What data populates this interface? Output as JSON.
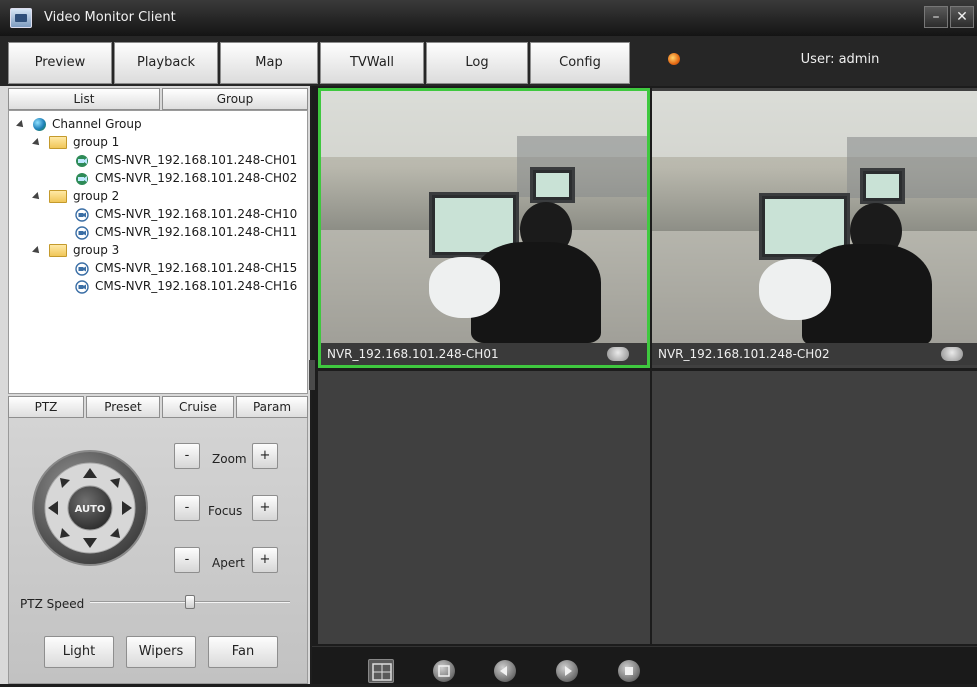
{
  "window": {
    "title": "Video Monitor Client",
    "minimize_glyph": "–",
    "close_glyph": "✕"
  },
  "nav": {
    "tabs": [
      {
        "label": "Preview"
      },
      {
        "label": "Playback"
      },
      {
        "label": "Map"
      },
      {
        "label": "TVWall"
      },
      {
        "label": "Log"
      },
      {
        "label": "Config"
      }
    ],
    "user_label": "User: admin"
  },
  "left": {
    "tabs": [
      "List",
      "Group"
    ],
    "tree": {
      "root": "Channel Group",
      "groups": [
        {
          "name": "group 1",
          "channels": [
            "CMS-NVR_192.168.101.248-CH01",
            "CMS-NVR_192.168.101.248-CH02"
          ]
        },
        {
          "name": "group 2",
          "channels": [
            "CMS-NVR_192.168.101.248-CH10",
            "CMS-NVR_192.168.101.248-CH11"
          ]
        },
        {
          "name": "group 3",
          "channels": [
            "CMS-NVR_192.168.101.248-CH15",
            "CMS-NVR_192.168.101.248-CH16"
          ]
        }
      ]
    },
    "ptz_tabs": [
      "PTZ",
      "Preset",
      "Cruise",
      "Param"
    ],
    "ptz": {
      "auto_label": "AUTO",
      "controls": [
        {
          "label": "Zoom",
          "minus": "-",
          "plus": "+"
        },
        {
          "label": "Focus",
          "minus": "-",
          "plus": "+"
        },
        {
          "label": "Apert",
          "minus": "-",
          "plus": "+"
        }
      ],
      "speed_label": "PTZ Speed",
      "speed_level": 0.5,
      "buttons": [
        "Light",
        "Wipers",
        "Fan"
      ]
    }
  },
  "video": {
    "tiles": [
      {
        "caption": "NVR_192.168.101.248-CH01",
        "selected": true
      },
      {
        "caption": "NVR_192.168.101.248-CH02",
        "selected": false
      },
      {
        "caption": "",
        "selected": false
      },
      {
        "caption": "",
        "selected": false
      }
    ],
    "selected_border_color": "#3fc83f",
    "toolbar_icons": [
      "layout-grid-icon",
      "fullscreen-icon",
      "previous-icon",
      "next-icon",
      "stop-all-icon"
    ]
  },
  "colors": {
    "accent_green": "#3fc83f",
    "titlebar": "#1e1e1e",
    "panel": "#d9d9d9"
  }
}
